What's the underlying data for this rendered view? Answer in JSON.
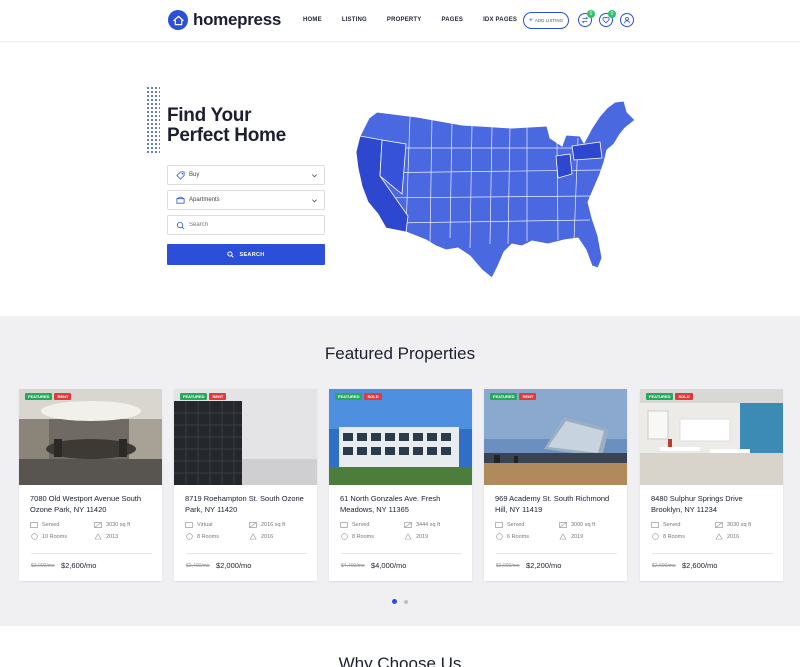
{
  "brand": {
    "name": "homepress"
  },
  "nav": [
    {
      "label": "HOME"
    },
    {
      "label": "LISTING"
    },
    {
      "label": "PROPERTY"
    },
    {
      "label": "PAGES"
    },
    {
      "label": "IDX PAGES"
    }
  ],
  "header": {
    "add_listing": "ADD LISTING",
    "compare_count": "0",
    "favorites_count": "0",
    "icons": [
      "compare-icon",
      "heart-icon",
      "user-icon"
    ]
  },
  "hero": {
    "title_line1": "Find Your",
    "title_line2": "Perfect Home",
    "deal_select": "Buy",
    "type_select": "Apartments",
    "search_placeholder": "Search",
    "search_button": "SEARCH"
  },
  "featured": {
    "title": "Featured Properties",
    "cards": [
      {
        "badge_featured": "FEATURED",
        "badge_type": "RENT",
        "title": "7080 Old Westport Avenue South Ozone Park, NY 11420",
        "status": "Served",
        "area": "3030 sq ft",
        "rooms": "10 Rooms",
        "year": "2013",
        "old_price": "$3,000/mo",
        "price": "$2,600/mo"
      },
      {
        "badge_featured": "FEATURED",
        "badge_type": "RENT",
        "title": "8719 Roehampton St. South Ozone Park, NY 11420",
        "status": "Virtual",
        "area": "2016 sq ft",
        "rooms": "8 Rooms",
        "year": "2016",
        "old_price": "$2,400/mo",
        "price": "$2,000/mo"
      },
      {
        "badge_featured": "FEATURED",
        "badge_type": "SOLD",
        "title": "61 North Gonzales Ave. Fresh Meadows, NY 11365",
        "status": "Served",
        "area": "3444 sq ft",
        "rooms": "8 Rooms",
        "year": "2019",
        "old_price": "$4,400/mo",
        "price": "$4,000/mo"
      },
      {
        "badge_featured": "FEATURED",
        "badge_type": "RENT",
        "title": "969 Academy St. South Richmond Hill, NY 11419",
        "status": "Served",
        "area": "3000 sq ft",
        "rooms": "6 Rooms",
        "year": "2019",
        "old_price": "$3,000/mo",
        "price": "$2,200/mo"
      },
      {
        "badge_featured": "FEATURED",
        "badge_type": "SOLD",
        "title": "8480 Sulphur Springs Drive Brooklyn, NY 11234",
        "status": "Served",
        "area": "3030 sq ft",
        "rooms": "8 Rooms",
        "year": "2016",
        "old_price": "$2,600/mo",
        "price": "$2,600/mo"
      }
    ],
    "pager": {
      "pages": 2,
      "active": 1
    }
  },
  "why": {
    "title": "Why Choose Us"
  },
  "colors": {
    "accent": "#2b4fd8",
    "featured_badge": "#27a85a",
    "type_badge": "#e23a3a",
    "section_bg": "#f0f0f2"
  }
}
